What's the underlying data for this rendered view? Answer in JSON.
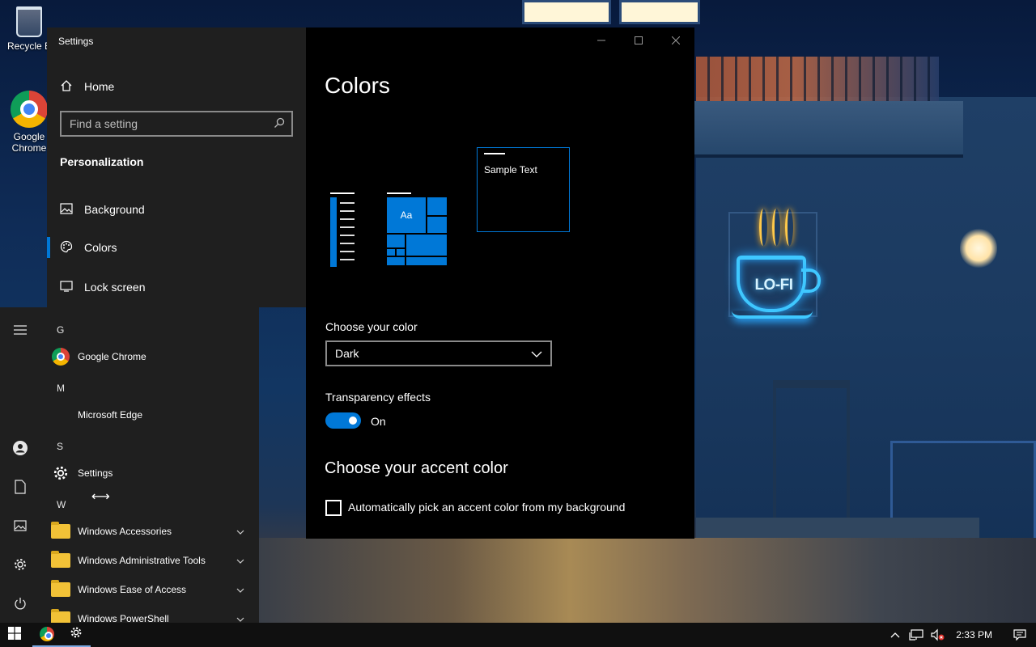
{
  "desktop": {
    "icons": [
      {
        "label": "Recycle Bin",
        "display": "Recycle B"
      },
      {
        "label": "Google Chrome",
        "display_line1": "Google",
        "display_line2": "Chrome"
      }
    ],
    "wallpaper_sign": "LO-FI"
  },
  "settings": {
    "window_title": "Settings",
    "home_label": "Home",
    "search_placeholder": "Find a setting",
    "section_heading": "Personalization",
    "nav_items": [
      {
        "label": "Background",
        "icon": "image-icon"
      },
      {
        "label": "Colors",
        "icon": "palette-icon",
        "selected": true
      },
      {
        "label": "Lock screen",
        "icon": "lock-screen-icon"
      }
    ],
    "page_title": "Colors",
    "preview": {
      "tile_text": "Aa",
      "sample_text": "Sample Text"
    },
    "choose_color_label": "Choose your color",
    "choose_color_value": "Dark",
    "transparency_label": "Transparency effects",
    "transparency_state": "On",
    "accent_heading": "Choose your accent color",
    "auto_accent_label": "Automatically pick an accent color from my background",
    "auto_accent_checked": false,
    "accent_color": "#0078d7"
  },
  "start_menu": {
    "groups": [
      {
        "letter": "G",
        "apps": [
          {
            "name": "Google Chrome",
            "icon": "chrome-icon"
          }
        ]
      },
      {
        "letter": "M",
        "apps": [
          {
            "name": "Microsoft Edge",
            "icon": ""
          }
        ]
      },
      {
        "letter": "S",
        "apps": [
          {
            "name": "Settings",
            "icon": "gear-icon"
          }
        ]
      },
      {
        "letter": "W",
        "apps": [
          {
            "name": "Windows Accessories",
            "icon": "folder-icon",
            "expandable": true
          },
          {
            "name": "Windows Administrative Tools",
            "icon": "folder-icon",
            "expandable": true
          },
          {
            "name": "Windows Ease of Access",
            "icon": "folder-icon",
            "expandable": true
          },
          {
            "name": "Windows PowerShell",
            "icon": "folder-icon",
            "expandable": true
          }
        ]
      }
    ],
    "rail_icons": [
      "hamburger-menu-icon",
      "user-icon",
      "documents-icon",
      "pictures-icon",
      "settings-gear-icon",
      "power-icon"
    ]
  },
  "taskbar": {
    "time": "2:33 PM",
    "pinned": [
      "windows-start-icon",
      "chrome-icon",
      "settings-gear-icon"
    ],
    "tray_icons": [
      "chevron-up-icon",
      "network-icon",
      "volume-muted-icon",
      "notification-icon"
    ]
  }
}
